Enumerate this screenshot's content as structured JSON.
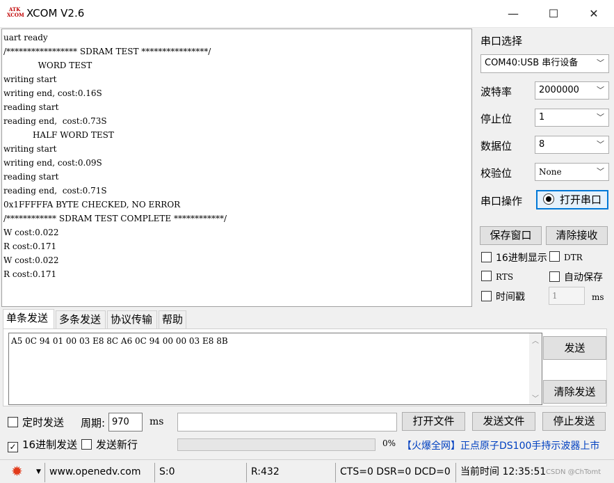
{
  "window": {
    "title": "XCOM V2.6",
    "logo_text": "ATK XCOM",
    "minimize": "—",
    "maximize": "☐",
    "close": "✕"
  },
  "receive_lines": [
    "uart ready",
    "/***************** SDRAM TEST ****************/",
    "             WORD TEST",
    "writing start",
    "writing end, cost:0.16S",
    "reading start",
    "reading end,  cost:0.73S",
    "           HALF WORD TEST",
    "writing start",
    "writing end, cost:0.09S",
    "reading start",
    "reading end,  cost:0.71S",
    "0x1FFFFFA BYTE CHECKED, NO ERROR",
    "/************ SDRAM TEST COMPLETE ************/",
    "W cost:0.022",
    "R cost:0.171",
    "W cost:0.022",
    "R cost:0.171"
  ],
  "settings": {
    "title": "串口选择",
    "port": "COM40:USB 串行设备",
    "baud_label": "波特率",
    "baud": "2000000",
    "stopbit_label": "停止位",
    "stopbit": "1",
    "databit_label": "数据位",
    "databit": "8",
    "parity_label": "校验位",
    "parity": "None",
    "op_label": "串口操作",
    "open_port": "打开串口",
    "save_window": "保存窗口",
    "clear_receive": "清除接收",
    "hex_display": "16进制显示",
    "dtr": "DTR",
    "rts": "RTS",
    "auto_save": "自动保存",
    "timestamp": "时间戳",
    "timestamp_value": "1",
    "timestamp_unit": "ms"
  },
  "tabs": [
    "单条发送",
    "多条发送",
    "协议传输",
    "帮助"
  ],
  "send": {
    "content": "A5 0C 94 01 00 03 E8 8C A6 0C 94 00 00 03 E8 8B",
    "send_button": "发送",
    "clear_send": "清除发送",
    "timed_send": "定时发送",
    "period_label": "周期:",
    "period": "970",
    "period_unit": "ms",
    "open_file": "打开文件",
    "send_file": "发送文件",
    "stop_send": "停止发送",
    "hex_send": "16进制发送",
    "hex_send_checked": true,
    "newline": "发送新行",
    "progress_text": "0%",
    "ad_text": "【火爆全网】正点原子DS100手持示波器上市"
  },
  "status": {
    "url": "www.openedv.com",
    "sent": "S:0",
    "received": "R:432",
    "lines": "CTS=0 DSR=0 DCD=0",
    "time": "当前时间 12:35:51",
    "watermark": "CSDN @ChTomt"
  },
  "colors": {
    "accent": "#0078d7",
    "ad": "#0040c0",
    "gear": "#e23a1a",
    "logo": "#c00000"
  }
}
